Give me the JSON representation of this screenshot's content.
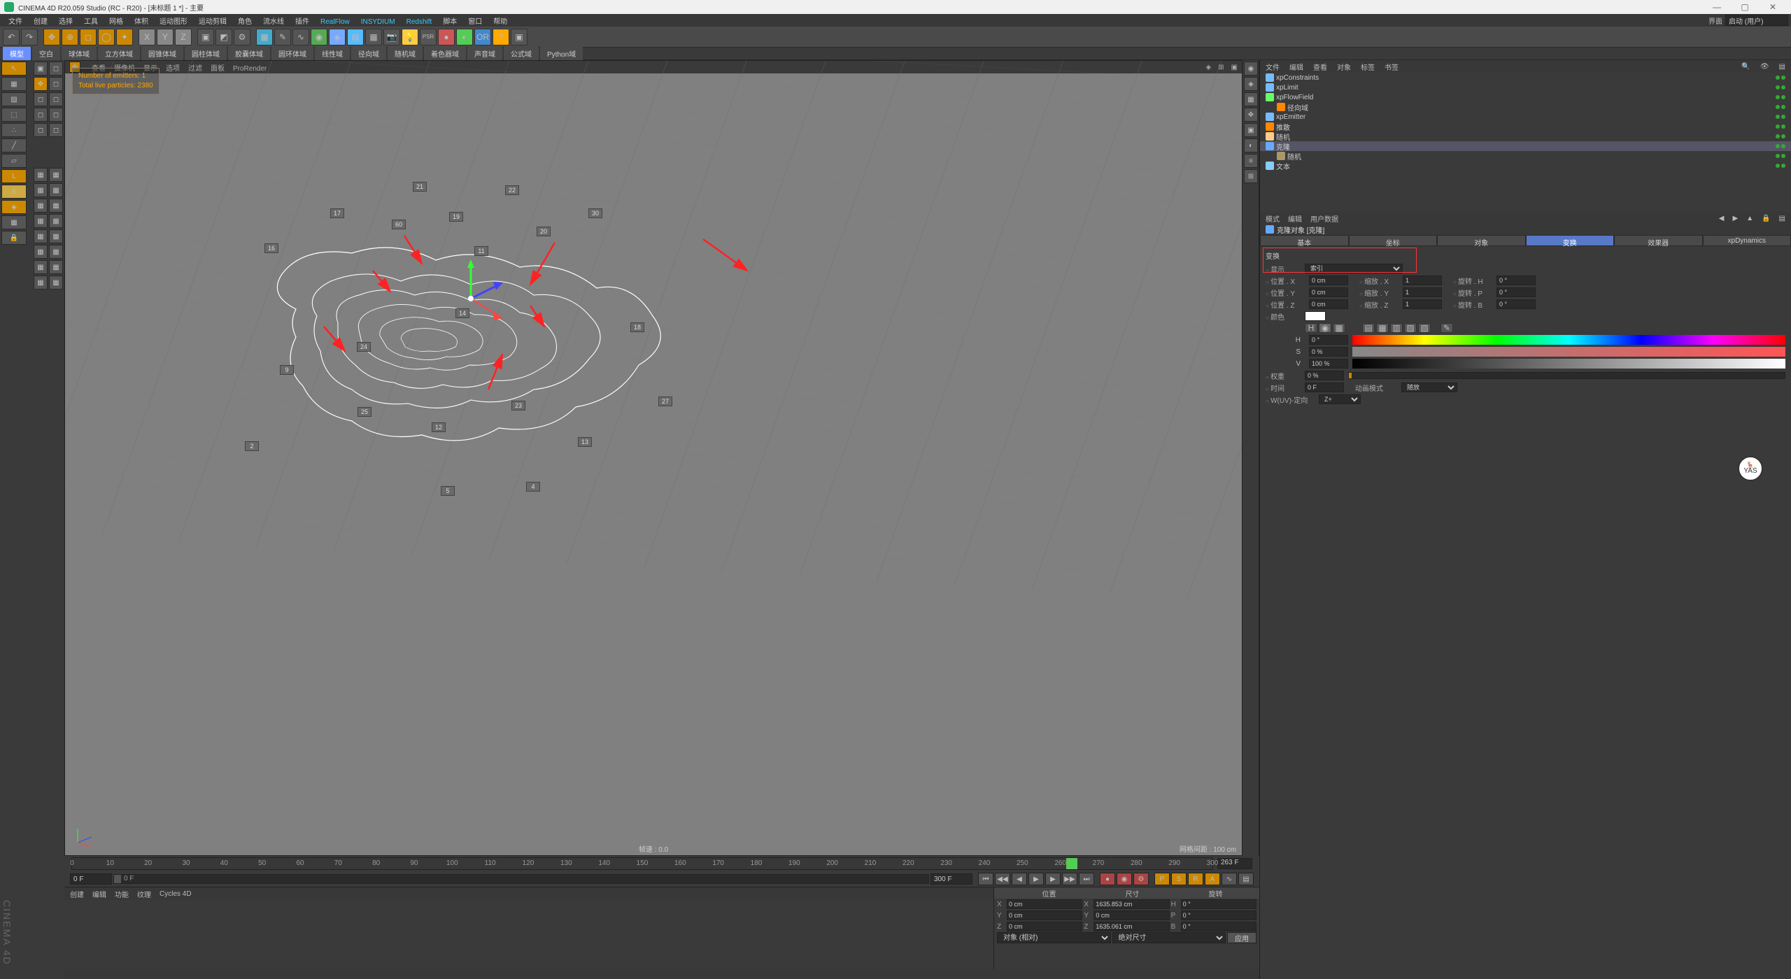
{
  "title": "CINEMA 4D R20.059 Studio (RC - R20) - [未标题 1 *] - 主要",
  "menus": [
    "文件",
    "创建",
    "选择",
    "工具",
    "网格",
    "体积",
    "运动图形",
    "运动剪辑",
    "角色",
    "流水线",
    "插件",
    "RealFlow",
    "INSYDIUM",
    "Redshift",
    "脚本",
    "窗口",
    "帮助"
  ],
  "menuRightLabel": "界面",
  "menuRightDrop": "启动 (用户)",
  "toolbarTabs": [
    "模型",
    "空白",
    "球体域",
    "立方体域",
    "圆锥体域",
    "圆柱体域",
    "胶囊体域",
    "圆环体域",
    "线性域",
    "径向域",
    "随机域",
    "着色器域",
    "声音域",
    "公式域",
    "Python域"
  ],
  "viewportTabs": [
    "查看",
    "摄像机",
    "显示",
    "选项",
    "过滤",
    "面板",
    "ProRender"
  ],
  "overlay": {
    "l1": "Number of emitters: 1",
    "l2": "Total live particles: 2380"
  },
  "statusFps": "帧速 : 0.0",
  "statusGrid": "网格间距 : 100 cm",
  "timelineTicks": [
    0,
    10,
    20,
    30,
    40,
    50,
    60,
    70,
    80,
    90,
    100,
    110,
    120,
    130,
    140,
    150,
    160,
    170,
    180,
    190,
    200,
    210,
    220,
    230,
    240,
    250,
    260,
    270,
    280,
    290,
    300
  ],
  "timelineCur": 263,
  "timelineEnd": "263 F",
  "frameStart": "0 F",
  "frameCur": "0 F",
  "frameEnd": "300 F",
  "bottomTabs": [
    "创建",
    "编辑",
    "功能",
    "纹理",
    "Cycles 4D"
  ],
  "coord": {
    "hdr": [
      "位置",
      "尺寸",
      "旋转"
    ],
    "rows": [
      {
        "a": "X",
        "p": "0 cm",
        "s": "1635.853 cm",
        "r": "0 °",
        "rl": "H"
      },
      {
        "a": "Y",
        "p": "0 cm",
        "s": "0 cm",
        "r": "0 °",
        "rl": "P"
      },
      {
        "a": "Z",
        "p": "0 cm",
        "s": "1635.061 cm",
        "r": "0 °",
        "rl": "B"
      }
    ],
    "modeA": "对象 (相对)",
    "modeB": "绝对尺寸",
    "apply": "应用"
  },
  "omMenus": [
    "文件",
    "编辑",
    "查看",
    "对象",
    "标签",
    "书签"
  ],
  "omTree": [
    {
      "n": "xpConstraints",
      "c": "#7bf",
      "d": 0
    },
    {
      "n": "xpLimit",
      "c": "#7bf",
      "d": 0
    },
    {
      "n": "xpFlowField",
      "c": "#6f6",
      "d": 0
    },
    {
      "n": "径向域",
      "c": "#f80",
      "d": 1
    },
    {
      "n": "xpEmitter",
      "c": "#7bf",
      "d": 0
    },
    {
      "n": "推散",
      "c": "#f80",
      "d": 0
    },
    {
      "n": "随机",
      "c": "#fc8",
      "d": 0
    },
    {
      "n": "克隆",
      "c": "#6af",
      "d": 0,
      "sel": true
    },
    {
      "n": "随机",
      "c": "#a96",
      "d": 1
    },
    {
      "n": "文本",
      "c": "#8cf",
      "d": 0
    }
  ],
  "attrMenus": [
    "模式",
    "编辑",
    "用户数据"
  ],
  "attrTitle": "克隆对象 [克隆]",
  "attrTabs": [
    "基本",
    "坐标",
    "对象",
    "变换",
    "效果器",
    "xpDynamics"
  ],
  "attrActiveTab": 3,
  "attrSection": "变换",
  "attrDisplay": {
    "lbl": "显示",
    "val": "索引"
  },
  "attrXYZ": [
    {
      "l": "位置 . X",
      "v": "0 cm",
      "l2": "缩放 . X",
      "v2": "1",
      "l3": "旋转 . H",
      "v3": "0 °"
    },
    {
      "l": "位置 . Y",
      "v": "0 cm",
      "l2": "缩放 . Y",
      "v2": "1",
      "l3": "旋转 . P",
      "v3": "0 °"
    },
    {
      "l": "位置 . Z",
      "v": "0 cm",
      "l2": "缩放 . Z",
      "v2": "1",
      "l3": "旋转 . B",
      "v3": "0 °"
    }
  ],
  "attrColor": {
    "lbl": "颜色",
    "H": "0 °",
    "S": "0 %",
    "V": "100 %"
  },
  "attrWeight": {
    "lbl": "权重",
    "v": "0 %"
  },
  "attrTime": {
    "lbl": "时间",
    "v": "0 F",
    "modeLbl": "动画模式",
    "mode": "随放"
  },
  "attrUV": {
    "lbl": "W(UV)-定向",
    "v": "Z+"
  },
  "nodeLabels": [
    [
      497,
      173,
      "21"
    ],
    [
      629,
      178,
      "22"
    ],
    [
      379,
      211,
      "17"
    ],
    [
      467,
      227,
      "60"
    ],
    [
      549,
      216,
      "19"
    ],
    [
      748,
      211,
      "30"
    ],
    [
      674,
      237,
      "20"
    ],
    [
      808,
      374,
      "18"
    ],
    [
      417,
      402,
      "24"
    ],
    [
      307,
      435,
      "9"
    ],
    [
      257,
      544,
      "2"
    ],
    [
      418,
      495,
      "25"
    ],
    [
      524,
      517,
      "12"
    ],
    [
      638,
      486,
      "23"
    ],
    [
      733,
      538,
      "13"
    ],
    [
      848,
      480,
      "27"
    ],
    [
      537,
      608,
      "5"
    ],
    [
      659,
      602,
      "4"
    ],
    [
      285,
      261,
      "16"
    ],
    [
      585,
      265,
      "11"
    ],
    [
      558,
      354,
      "14"
    ]
  ],
  "arrows": [
    [
      485,
      250,
      510,
      290
    ],
    [
      700,
      260,
      665,
      320
    ],
    [
      440,
      300,
      465,
      330
    ],
    [
      370,
      380,
      400,
      415
    ],
    [
      665,
      350,
      685,
      380
    ],
    [
      605,
      470,
      625,
      420
    ],
    [
      912,
      255,
      975,
      300
    ]
  ],
  "brandingText": "CINEMA 4D"
}
